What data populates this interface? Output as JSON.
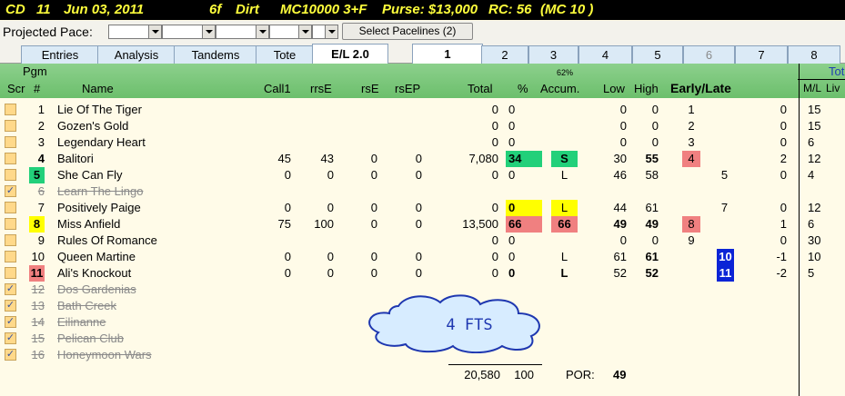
{
  "header": {
    "track": "CD",
    "race_no": "11",
    "date": "Jun 03, 2011",
    "distance": "6f",
    "surface": "Dirt",
    "race_class": "MC10000 3+F",
    "purse": "Purse: $13,000",
    "rc": "RC: 56",
    "class_note": "(MC 10 )"
  },
  "pace": {
    "label": "Projected Pace:",
    "button": "Select Pacelines  (2)"
  },
  "tabs": {
    "left": [
      "Entries",
      "Analysis",
      "Tandems",
      "Tote",
      "E/L 2.0"
    ],
    "selected_left": "E/L 2.0",
    "numbers": [
      "1",
      "2",
      "3",
      "4",
      "5",
      "6",
      "7",
      "8"
    ],
    "selected_number": "1",
    "disabled_number": "6"
  },
  "columns": {
    "pgm_top": "Pgm",
    "scr": "Scr",
    "num": "#",
    "name": "Name",
    "call1": "Call1",
    "rrse": "rrsE",
    "rse": "rsE",
    "rsep": "rsEP",
    "total": "Total",
    "pct": "%",
    "pct_top": "62%",
    "accum": "Accum.",
    "low": "Low",
    "high": "High",
    "early_late": "Early/Late",
    "tote_top": "Tot",
    "ml": "M/L",
    "live": "Liv"
  },
  "rows": [
    {
      "pgm": "1",
      "name": "Lie Of The Tiger",
      "call1": "",
      "rrse": "",
      "rse": "",
      "rsep": "",
      "total": "0",
      "pct": "0",
      "pct_sup": "",
      "accum": "",
      "low": "0",
      "high": "0",
      "early": "1",
      "late": "",
      "tote": "0",
      "ml": "15",
      "scratched": false
    },
    {
      "pgm": "2",
      "name": "Gozen's Gold",
      "call1": "",
      "rrse": "",
      "rse": "",
      "rsep": "",
      "total": "0",
      "pct": "0",
      "pct_sup": "",
      "accum": "",
      "low": "0",
      "high": "0",
      "early": "2",
      "late": "",
      "tote": "0",
      "ml": "15",
      "scratched": false
    },
    {
      "pgm": "3",
      "name": "Legendary Heart",
      "call1": "",
      "rrse": "",
      "rse": "",
      "rsep": "",
      "total": "0",
      "pct": "0",
      "pct_sup": "",
      "accum": "",
      "low": "0",
      "high": "0",
      "early": "3",
      "late": "",
      "tote": "0",
      "ml": "6",
      "scratched": false
    },
    {
      "pgm": "4",
      "name": "Balitori",
      "call1": "45",
      "rrse": "43",
      "rse": "0",
      "rsep": "0",
      "total": "7,080",
      "pct": "34",
      "pct_sup": "2",
      "accum": "S",
      "low": "30",
      "high": "55",
      "early": "4",
      "late": "",
      "tote": "2",
      "ml": "12",
      "scratched": false
    },
    {
      "pgm": "5",
      "name": "She Can Fly",
      "call1": "0",
      "rrse": "0",
      "rse": "0",
      "rsep": "0",
      "total": "0",
      "pct": "0",
      "pct_sup": "6",
      "accum": "L",
      "low": "46",
      "high": "58",
      "early": "",
      "late": "5",
      "tote": "0",
      "ml": "4",
      "scratched": false
    },
    {
      "pgm": "6",
      "name": "Learn The Lingo",
      "call1": "",
      "rrse": "",
      "rse": "",
      "rsep": "",
      "total": "",
      "pct": "",
      "pct_sup": "",
      "accum": "",
      "low": "",
      "high": "",
      "early": "",
      "late": "",
      "tote": "",
      "ml": "",
      "scratched": true
    },
    {
      "pgm": "7",
      "name": "Positively Paige",
      "call1": "0",
      "rrse": "0",
      "rse": "0",
      "rsep": "0",
      "total": "0",
      "pct": "0",
      "pct_sup": "3",
      "accum": "L",
      "low": "44",
      "high": "61",
      "early": "",
      "late": "7",
      "tote": "0",
      "ml": "12",
      "scratched": false
    },
    {
      "pgm": "8",
      "name": "Miss Anfield",
      "call1": "75",
      "rrse": "100",
      "rse": "0",
      "rsep": "0",
      "total": "13,500",
      "pct": "66",
      "pct_sup": "1",
      "accum": "66",
      "low": "49",
      "high": "49",
      "early": "8",
      "late": "",
      "tote": "1",
      "ml": "6",
      "scratched": false
    },
    {
      "pgm": "9",
      "name": "Rules Of Romance",
      "call1": "",
      "rrse": "",
      "rse": "",
      "rsep": "",
      "total": "0",
      "pct": "0",
      "pct_sup": "",
      "accum": "",
      "low": "0",
      "high": "0",
      "early": "9",
      "late": "",
      "tote": "0",
      "ml": "30",
      "scratched": false
    },
    {
      "pgm": "10",
      "name": "Queen Martine",
      "call1": "0",
      "rrse": "0",
      "rse": "0",
      "rsep": "0",
      "total": "0",
      "pct": "0",
      "pct_sup": "5",
      "accum": "L",
      "low": "61",
      "high": "61",
      "early": "",
      "late": "10",
      "tote": "-1",
      "ml": "10",
      "scratched": false
    },
    {
      "pgm": "11",
      "name": "Ali's Knockout",
      "call1": "0",
      "rrse": "0",
      "rse": "0",
      "rsep": "0",
      "total": "0",
      "pct": "0",
      "pct_sup": "4",
      "accum": "L",
      "low": "52",
      "high": "52",
      "early": "",
      "late": "11",
      "tote": "-2",
      "ml": "5",
      "scratched": false
    },
    {
      "pgm": "12",
      "name": "Dos Gardenias",
      "scratched": true
    },
    {
      "pgm": "13",
      "name": "Bath Creek",
      "scratched": true
    },
    {
      "pgm": "14",
      "name": "Eilinanne",
      "scratched": true
    },
    {
      "pgm": "15",
      "name": "Pelican Club",
      "scratched": true
    },
    {
      "pgm": "16",
      "name": "Honeymoon Wars",
      "scratched": true
    }
  ],
  "cloud": {
    "text": "4 FTS"
  },
  "footer": {
    "total": "20,580",
    "pct": "100",
    "por_label": "POR:",
    "por_value": "49"
  },
  "colors": {
    "green": "#22d07a",
    "yellow": "#ffff00",
    "red": "#f08080",
    "blue": "#0b24d6",
    "header": "#7cc87c"
  }
}
